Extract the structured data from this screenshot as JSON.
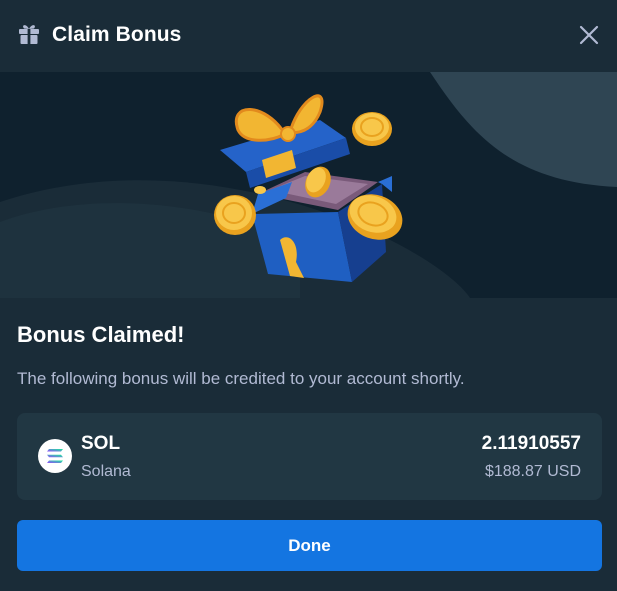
{
  "header": {
    "title": "Claim Bonus",
    "icon": "gift-icon",
    "close_icon": "close-icon"
  },
  "banner": {
    "illustration": "gift-box-with-coins"
  },
  "main": {
    "title": "Bonus Claimed!",
    "subtitle": "The following bonus will be credited to your account shortly."
  },
  "bonus": {
    "symbol": "SOL",
    "name": "Solana",
    "amount": "2.11910557",
    "fiat": "$188.87 USD",
    "icon": "solana-icon"
  },
  "actions": {
    "done_label": "Done"
  },
  "colors": {
    "background": "#1a2c38",
    "banner": "#0f212e",
    "card": "#213743",
    "accent": "#1475e1",
    "muted_text": "#b1bad3"
  }
}
